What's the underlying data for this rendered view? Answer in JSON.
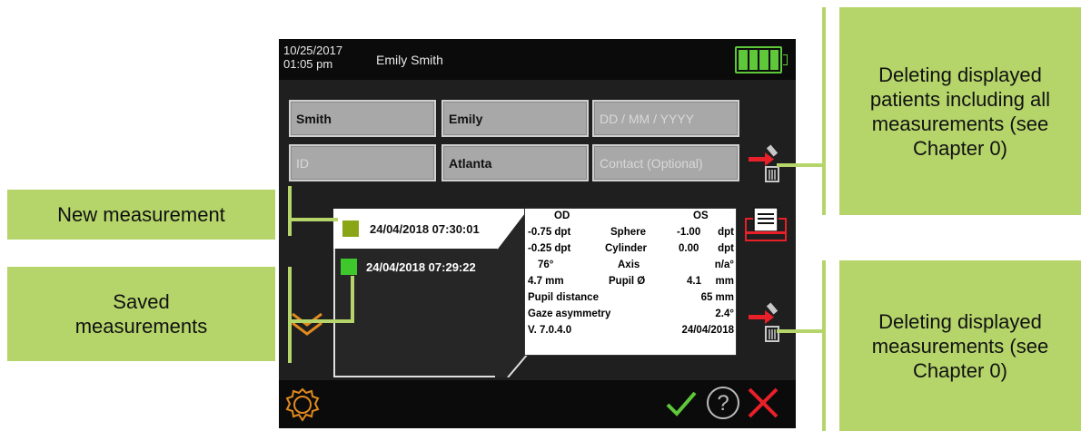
{
  "status": {
    "date": "10/25/2017\n01:05 pm",
    "user": "Emily Smith"
  },
  "patient": {
    "last_name": "Smith",
    "first_name": "Emily",
    "dob_placeholder": "DD  /  MM  /  YYYY",
    "id_placeholder": "ID",
    "city": "Atlanta",
    "contact_placeholder": "Contact (Optional)"
  },
  "measurements": {
    "new": {
      "timestamp": "24/04/2018 07:30:01",
      "color": "#8aa617"
    },
    "saved": [
      {
        "timestamp": "24/04/2018 07:29:22",
        "color": "#3fc82c"
      }
    ]
  },
  "results": {
    "od_header": "OD",
    "os_header": "OS",
    "rows": [
      {
        "od": "-0.75 dpt",
        "label": "Sphere",
        "os_val": "-1.00",
        "os_unit": "dpt"
      },
      {
        "od": "-0.25 dpt",
        "label": "Cylinder",
        "os_val": "0.00",
        "os_unit": "dpt"
      },
      {
        "od": "76°",
        "label": "Axis",
        "os_val": "",
        "os_unit": "n/a°"
      },
      {
        "od": "4.7    mm",
        "label": "Pupil Ø",
        "os_val": "4.1",
        "os_unit": "mm"
      }
    ],
    "pupil_distance": {
      "label": "Pupil distance",
      "value": "65   mm"
    },
    "gaze_asymmetry": {
      "label": "Gaze asymmetry",
      "value": "2.4°"
    },
    "version": "V. 7.0.4.0",
    "date": "24/04/2018"
  },
  "callouts": {
    "delete_patients": "Deleting displayed patients including all measurements (see Chapter 0)",
    "new_measurement": "New measurement",
    "saved_measurements": "Saved measurements",
    "delete_measurements": "Deleting displayed measurements (see Chapter 0)"
  },
  "colors": {
    "accent_green": "#5ec83a",
    "callout_green": "#b5d56a",
    "delete_red": "#e8202a",
    "settings_orange": "#e08a1e"
  }
}
